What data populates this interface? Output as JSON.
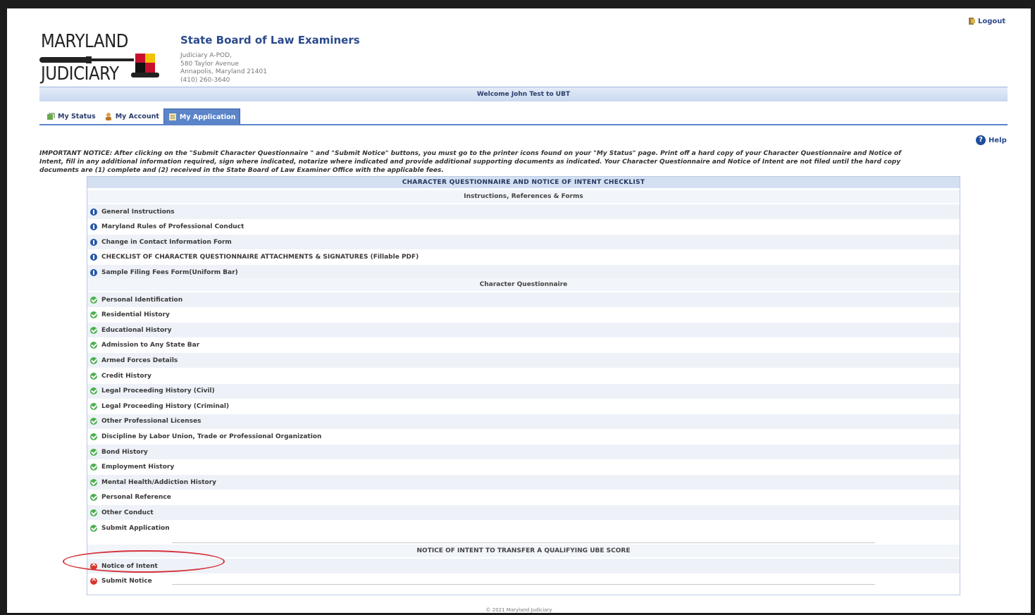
{
  "logo": {
    "line1": "MARYLAND",
    "line2": "JUDICIARY"
  },
  "header": {
    "title": "State Board of Law Examiners",
    "address": [
      "Judiciary A-POD,",
      "580 Taylor Avenue",
      "Annapolis, Maryland 21401",
      "(410) 260-3640"
    ],
    "logout": "Logout"
  },
  "welcome": "Welcome John Test to UBT",
  "tabs": [
    {
      "label": "My Status",
      "icon": "status-icon"
    },
    {
      "label": "My Account",
      "icon": "account-icon"
    },
    {
      "label": "My Application",
      "icon": "application-icon",
      "active": true
    }
  ],
  "help": "Help",
  "notice": [
    "IMPORTANT NOTICE: After clicking on the \"Submit Character Questionnaire \" and \"Submit Notice\" buttons, you must go to the printer icons found on your \"My Status\" page. Print off a hard copy of your Character Questionnaire and Notice of",
    "Intent, fill in any additional information required, sign where indicated, notarize where indicated and provide additional supporting documents as indicated. Your Character Questionnaire and Notice of Intent are not filed until the hard copy",
    "documents are (1) complete and (2) received in the State Board of Law Examiner Office with the applicable fees."
  ],
  "checklist": {
    "title": "CHARACTER QUESTIONNAIRE AND NOTICE OF INTENT CHECKLIST",
    "sections": [
      {
        "heading": "Instructions, References & Forms",
        "items": [
          "General Instructions",
          "Maryland Rules of Professional Conduct",
          "Change in Contact Information Form",
          "CHECKLIST OF CHARACTER QUESTIONNAIRE ATTACHMENTS & SIGNATURES (Fillable PDF)",
          "Sample Filing Fees Form(Uniform Bar)"
        ]
      },
      {
        "heading": "Character Questionnaire",
        "items": [
          "Personal Identification",
          "Residential History",
          "Educational History",
          "Admission to Any State Bar",
          "Armed Forces Details",
          "Credit History",
          "Legal Proceeding History (Civil)",
          "Legal Proceeding History (Criminal)",
          "Other Professional Licenses",
          "Discipline by Labor Union, Trade or Professional Organization",
          "Bond History",
          "Employment History",
          "Mental Health/Addiction History",
          "Personal Reference",
          "Other Conduct",
          "Submit Application"
        ]
      },
      {
        "heading": "NOTICE OF INTENT TO TRANSFER A QUALIFYING UBE SCORE",
        "items": [
          "Notice of Intent",
          "Submit Notice"
        ]
      }
    ]
  },
  "footer": "© 2021 Maryland Judiciary",
  "colors": {
    "accent": "#5b84c9",
    "complete": "#4caf50",
    "incomplete": "#d9342b",
    "info": "#2657a8"
  }
}
